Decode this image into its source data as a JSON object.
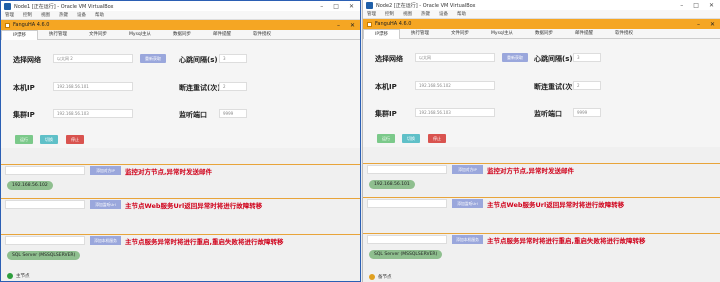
{
  "windows": [
    {
      "title": "Node1 [正在运行] - Oracle VM VirtualBox",
      "menu": [
        "管理",
        "控制",
        "视图",
        "热键",
        "设备",
        "帮助"
      ],
      "app_title": "FanguHA 4.6.0",
      "tabs": [
        "IP漂移",
        "执行管理",
        "文件同步",
        "Mysql主从",
        "数据同步",
        "邮件提醒",
        "软件授权"
      ],
      "form": {
        "network_label": "选择网络",
        "network_value": "以太网 2",
        "network_btn": "重新获取",
        "heartbeat_label": "心跳间隔(s)",
        "heartbeat_value": "3",
        "local_ip_label": "本机IP",
        "local_ip_value": "192.168.56.101",
        "retry_label": "断连重试(次)",
        "retry_value": "2",
        "cluster_ip_label": "集群IP",
        "cluster_ip_value": "192.168.56.103",
        "port_label": "监听端口",
        "port_value": "9999",
        "run_btn": "运行",
        "switch_btn": "切换",
        "stop_btn": "停止"
      },
      "sections": [
        {
          "button": "添加对方IP",
          "text": "监控对方节点,异常时发送邮件",
          "pill": "192.168.56.102"
        },
        {
          "button": "添加监听Url",
          "text": "主节点Web服务Url返回异常时将进行故障转移",
          "pill": ""
        },
        {
          "button": "添加本机服务",
          "text": "主节点服务异常时将进行重启,重启失败将进行故障转移",
          "pill": "SQL Server (MSSQLSERVER)"
        }
      ],
      "status": {
        "text": "主节点",
        "color": "#2e9e3e"
      }
    },
    {
      "title": "Node2 [正在运行] - Oracle VM VirtualBox",
      "menu": [
        "管理",
        "控制",
        "视图",
        "热键",
        "设备",
        "帮助"
      ],
      "app_title": "FanguHA 4.6.0",
      "tabs": [
        "IP漂移",
        "执行管理",
        "文件同步",
        "Mysql主从",
        "数据同步",
        "邮件提醒",
        "软件授权"
      ],
      "form": {
        "network_label": "选择网络",
        "network_value": "以太网",
        "network_btn": "重新获取",
        "heartbeat_label": "心跳间隔(s)",
        "heartbeat_value": "3",
        "local_ip_label": "本机IP",
        "local_ip_value": "192.168.56.102",
        "retry_label": "断连重试(次)",
        "retry_value": "2",
        "cluster_ip_label": "集群IP",
        "cluster_ip_value": "192.168.56.103",
        "port_label": "监听端口",
        "port_value": "9999",
        "run_btn": "运行",
        "switch_btn": "切换",
        "stop_btn": "停止"
      },
      "sections": [
        {
          "button": "添加对方IP",
          "text": "监控对方节点,异常时发送邮件",
          "pill": "192.168.56.101"
        },
        {
          "button": "添加监听Url",
          "text": "主节点Web服务Url返回异常时将进行故障转移",
          "pill": ""
        },
        {
          "button": "添加本机服务",
          "text": "主节点服务异常时将进行重启,重启失败将进行故障转移",
          "pill": "SQL Server (MSSQLSERVER)"
        }
      ],
      "status": {
        "text": "备节点",
        "color": "#e0a020"
      }
    }
  ]
}
